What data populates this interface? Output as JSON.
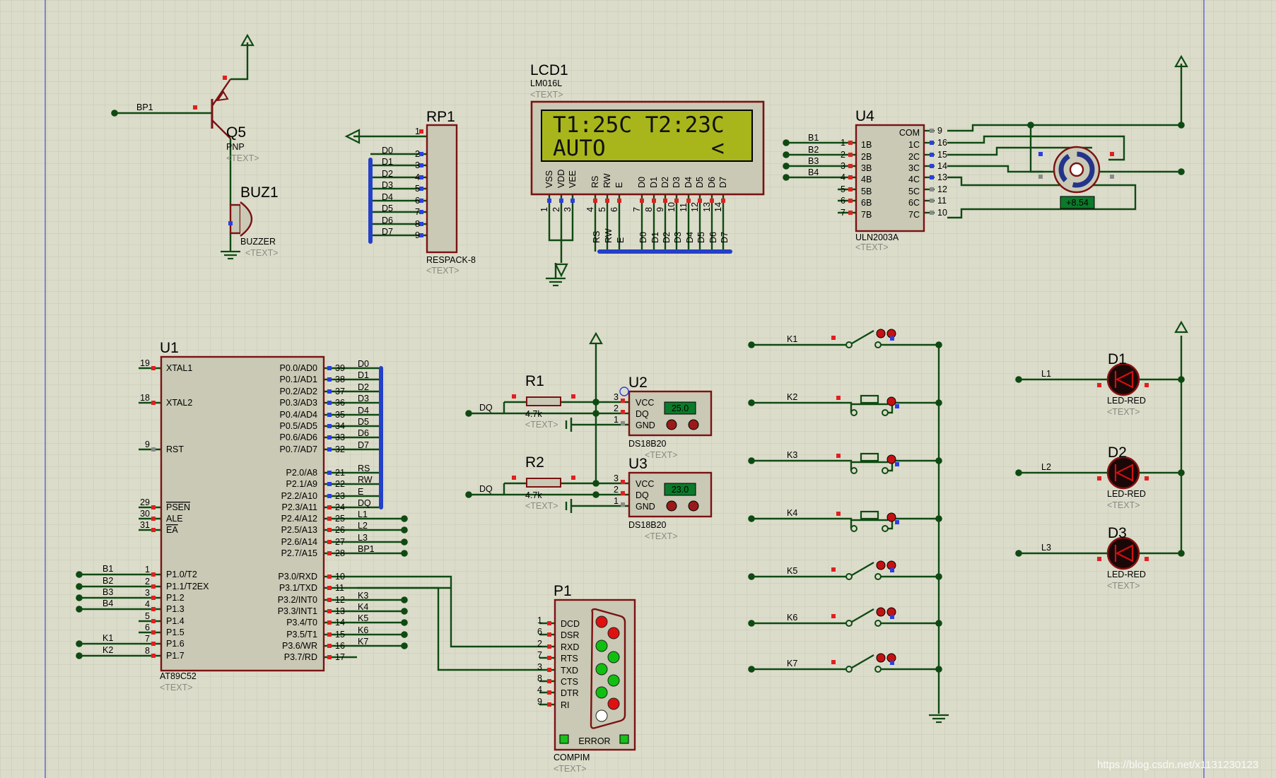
{
  "components": {
    "q5": {
      "ref": "Q5",
      "type": "PNP",
      "text": "<TEXT>"
    },
    "buz1": {
      "ref": "BUZ1",
      "type": "BUZZER",
      "text": "<TEXT>"
    },
    "rp1": {
      "ref": "RP1",
      "type": "RESPACK-8",
      "text": "<TEXT>",
      "pin_numbers": [
        "1",
        "2",
        "3",
        "4",
        "5",
        "6",
        "7",
        "8",
        "9"
      ],
      "labels": [
        "D0",
        "D1",
        "D2",
        "D3",
        "D4",
        "D5",
        "D6",
        "D7"
      ]
    },
    "lcd1": {
      "ref": "LCD1",
      "type": "LM016L",
      "text": "<TEXT>",
      "line1": "T1:25C T2:23C",
      "line2": "AUTO        <",
      "pin_names": [
        "VSS",
        "VDD",
        "VEE",
        "RS",
        "RW",
        "E",
        "D0",
        "D1",
        "D2",
        "D3",
        "D4",
        "D5",
        "D6",
        "D7"
      ],
      "pin_numbers": [
        "1",
        "2",
        "3",
        "4",
        "5",
        "6",
        "7",
        "8",
        "9",
        "10",
        "11",
        "12",
        "13",
        "14"
      ],
      "bus_labels": [
        "RS",
        "RW",
        "E",
        "D0",
        "D1",
        "D2",
        "D3",
        "D4",
        "D5",
        "D6",
        "D7"
      ]
    },
    "u4": {
      "ref": "U4",
      "type": "ULN2003A",
      "text": "<TEXT>",
      "left_pins": [
        {
          "num": "1",
          "name": "1B"
        },
        {
          "num": "2",
          "name": "2B"
        },
        {
          "num": "3",
          "name": "3B"
        },
        {
          "num": "4",
          "name": "4B"
        },
        {
          "num": "5",
          "name": "5B"
        },
        {
          "num": "6",
          "name": "6B"
        },
        {
          "num": "7",
          "name": "7B"
        }
      ],
      "right_pins": [
        {
          "num": "9",
          "name": "COM"
        },
        {
          "num": "16",
          "name": "1C"
        },
        {
          "num": "15",
          "name": "2C"
        },
        {
          "num": "14",
          "name": "3C"
        },
        {
          "num": "13",
          "name": "4C"
        },
        {
          "num": "12",
          "name": "5C"
        },
        {
          "num": "11",
          "name": "6C"
        },
        {
          "num": "10",
          "name": "7C"
        }
      ],
      "nets": [
        "B1",
        "B2",
        "B3",
        "B4"
      ]
    },
    "motor": {
      "readout": "+8.54"
    },
    "u1": {
      "ref": "U1",
      "type": "AT89C52",
      "text": "<TEXT>",
      "left_pins": [
        {
          "num": "19",
          "name": "XTAL1"
        },
        {
          "num": "18",
          "name": "XTAL2"
        },
        {
          "num": "9",
          "name": "RST"
        },
        {
          "num": "29",
          "name": "PSEN"
        },
        {
          "num": "30",
          "name": "ALE"
        },
        {
          "num": "31",
          "name": "EA"
        },
        {
          "num": "1",
          "name": "P1.0/T2"
        },
        {
          "num": "2",
          "name": "P1.1/T2EX"
        },
        {
          "num": "3",
          "name": "P1.2"
        },
        {
          "num": "4",
          "name": "P1.3"
        },
        {
          "num": "5",
          "name": "P1.4"
        },
        {
          "num": "6",
          "name": "P1.5"
        },
        {
          "num": "7",
          "name": "P1.6"
        },
        {
          "num": "8",
          "name": "P1.7"
        }
      ],
      "right_pins": [
        {
          "num": "39",
          "name": "P0.0/AD0"
        },
        {
          "num": "38",
          "name": "P0.1/AD1"
        },
        {
          "num": "37",
          "name": "P0.2/AD2"
        },
        {
          "num": "36",
          "name": "P0.3/AD3"
        },
        {
          "num": "35",
          "name": "P0.4/AD4"
        },
        {
          "num": "34",
          "name": "P0.5/AD5"
        },
        {
          "num": "33",
          "name": "P0.6/AD6"
        },
        {
          "num": "32",
          "name": "P0.7/AD7"
        },
        {
          "num": "21",
          "name": "P2.0/A8"
        },
        {
          "num": "22",
          "name": "P2.1/A9"
        },
        {
          "num": "23",
          "name": "P2.2/A10"
        },
        {
          "num": "24",
          "name": "P2.3/A11"
        },
        {
          "num": "25",
          "name": "P2.4/A12"
        },
        {
          "num": "26",
          "name": "P2.5/A13"
        },
        {
          "num": "27",
          "name": "P2.6/A14"
        },
        {
          "num": "28",
          "name": "P2.7/A15"
        },
        {
          "num": "10",
          "name": "P3.0/RXD"
        },
        {
          "num": "11",
          "name": "P3.1/TXD"
        },
        {
          "num": "12",
          "name": "P3.2/INT0"
        },
        {
          "num": "13",
          "name": "P3.3/INT1"
        },
        {
          "num": "14",
          "name": "P3.4/T0"
        },
        {
          "num": "15",
          "name": "P3.5/T1"
        },
        {
          "num": "16",
          "name": "P3.6/WR"
        },
        {
          "num": "17",
          "name": "P3.7/RD"
        }
      ],
      "right_nets": [
        "D0",
        "D1",
        "D2",
        "D3",
        "D4",
        "D5",
        "D6",
        "D7",
        "RS",
        "RW",
        "E",
        "DQ",
        "L1",
        "L2",
        "L3",
        "BP1",
        "",
        "",
        "K3",
        "K4",
        "K5",
        "K6",
        "K7",
        ""
      ],
      "left_nets": [
        "B1",
        "B2",
        "B3",
        "B4",
        "",
        "",
        "K1",
        "K2"
      ]
    },
    "r1": {
      "ref": "R1",
      "value": "4.7k",
      "text": "<TEXT>",
      "net": "DQ"
    },
    "r2": {
      "ref": "R2",
      "value": "4.7k",
      "text": "<TEXT>",
      "net": "DQ"
    },
    "u2": {
      "ref": "U2",
      "type": "DS18B20",
      "text": "<TEXT>",
      "reading": "25.0",
      "pins": [
        {
          "num": "3",
          "name": "VCC"
        },
        {
          "num": "2",
          "name": "DQ"
        },
        {
          "num": "1",
          "name": "GND"
        }
      ]
    },
    "u3": {
      "ref": "U3",
      "type": "DS18B20",
      "text": "<TEXT>",
      "reading": "23.0",
      "pins": [
        {
          "num": "3",
          "name": "VCC"
        },
        {
          "num": "2",
          "name": "DQ"
        },
        {
          "num": "1",
          "name": "GND"
        }
      ]
    },
    "p1": {
      "ref": "P1",
      "type": "COMPIM",
      "text": "<TEXT>",
      "status": "ERROR",
      "pins": [
        {
          "num": "1",
          "name": "DCD"
        },
        {
          "num": "6",
          "name": "DSR"
        },
        {
          "num": "2",
          "name": "RXD"
        },
        {
          "num": "7",
          "name": "RTS"
        },
        {
          "num": "3",
          "name": "TXD"
        },
        {
          "num": "8",
          "name": "CTS"
        },
        {
          "num": "4",
          "name": "DTR"
        },
        {
          "num": "9",
          "name": "RI"
        }
      ]
    },
    "switches": [
      {
        "label": "K1",
        "kind": "switch"
      },
      {
        "label": "K2",
        "kind": "button"
      },
      {
        "label": "K3",
        "kind": "button"
      },
      {
        "label": "K4",
        "kind": "button"
      },
      {
        "label": "K5",
        "kind": "switch"
      },
      {
        "label": "K6",
        "kind": "switch"
      },
      {
        "label": "K7",
        "kind": "switch"
      }
    ],
    "leds": [
      {
        "ref": "D1",
        "type": "LED-RED",
        "net": "L1",
        "text": "<TEXT>"
      },
      {
        "ref": "D2",
        "type": "LED-RED",
        "net": "L2",
        "text": "<TEXT>"
      },
      {
        "ref": "D3",
        "type": "LED-RED",
        "net": "L3",
        "text": "<TEXT>"
      }
    ],
    "bp1_net": "BP1"
  },
  "watermark": "https://blog.csdn.net/x1131230123",
  "colors": {
    "background": "#dcdccb",
    "grid": "#c8c8b6",
    "wire": "#0e4a12",
    "body_outline": "#7a1212",
    "body_fill": "#c9c9b5",
    "lcd_screen": "#a8b61c",
    "bus": "#2340c8",
    "pin_red": "#e02020",
    "pin_blue": "#2b3fe0"
  }
}
